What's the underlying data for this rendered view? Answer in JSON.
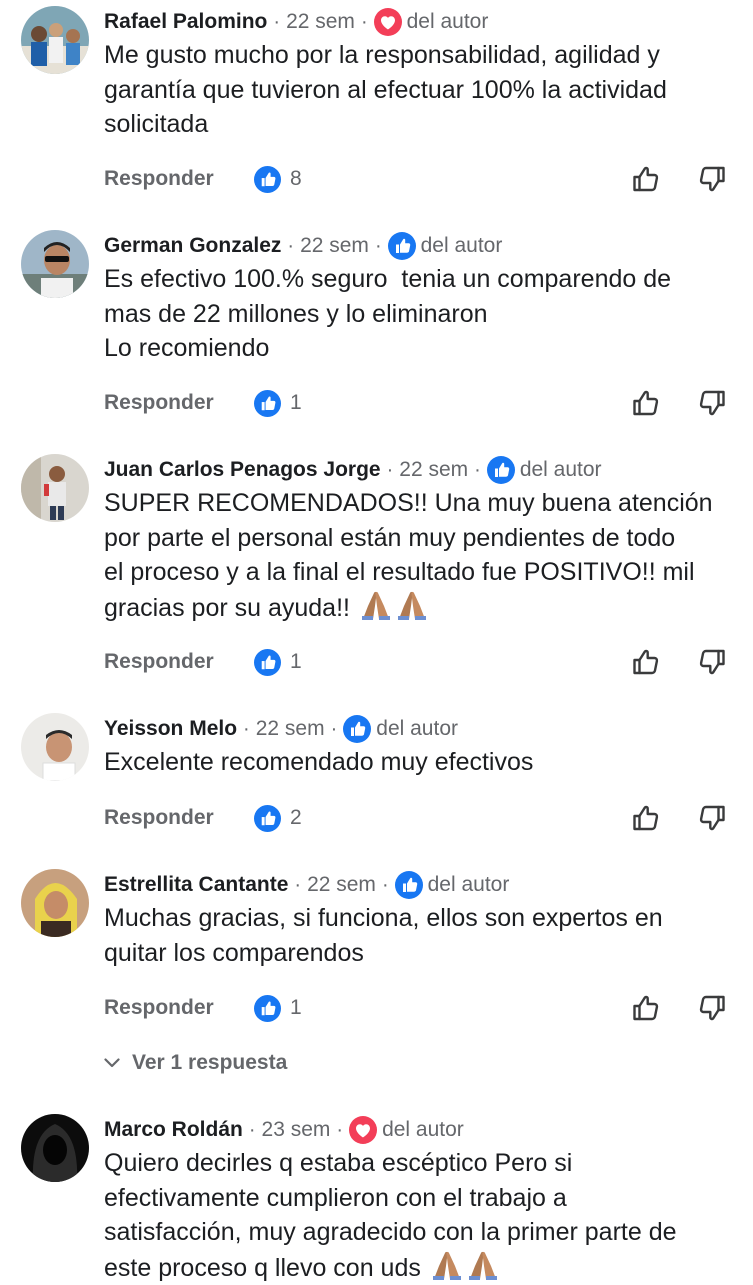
{
  "comments": [
    {
      "author": "Rafael Palomino",
      "time": "22 sem",
      "reaction": "heart",
      "author_reaction_label": "del autor",
      "text_lines": [
        "Me gusto mucho por la responsabilidad, agilidad y",
        "garantía que tuvieron al efectuar 100% la actividad",
        "solicitada"
      ],
      "reply_label": "Responder",
      "like_count": "8"
    },
    {
      "author": "German Gonzalez",
      "time": "22 sem",
      "reaction": "like",
      "author_reaction_label": "del autor",
      "text_lines": [
        "Es efectivo 100.% seguro  tenia un comparendo de",
        "mas de 22 millones y lo eliminaron",
        "Lo recomiendo"
      ],
      "reply_label": "Responder",
      "like_count": "1"
    },
    {
      "author": "Juan Carlos Penagos Jorge",
      "time": "22 sem",
      "reaction": "like",
      "author_reaction_label": "del autor",
      "text_lines": [
        "SUPER RECOMENDADOS!! Una muy buena atención",
        "por parte el personal están muy pendientes de todo",
        "el proceso y a la final el resultado fue POSITIVO!! mil",
        "gracias por su ayuda!!"
      ],
      "emoji_after": "🙏🏽🙏🏽",
      "reply_label": "Responder",
      "like_count": "1"
    },
    {
      "author": "Yeisson Melo",
      "time": "22 sem",
      "reaction": "like",
      "author_reaction_label": "del autor",
      "text_lines": [
        "Excelente recomendado muy efectivos"
      ],
      "reply_label": "Responder",
      "like_count": "2"
    },
    {
      "author": "Estrellita Cantante",
      "time": "22 sem",
      "reaction": "like",
      "author_reaction_label": "del autor",
      "text_lines": [
        "Muchas gracias, si funciona, ellos son expertos en",
        "quitar los comparendos"
      ],
      "reply_label": "Responder",
      "like_count": "1",
      "view_replies": "Ver 1 respuesta"
    },
    {
      "author": "Marco Roldán",
      "time": "23 sem",
      "reaction": "heart",
      "author_reaction_label": "del autor",
      "text_lines": [
        "Quiero decirles q estaba escéptico Pero si",
        "efectivamente cumplieron con el trabajo a",
        "satisfacción, muy agradecido con la primer parte de",
        "este proceso q llevo con uds"
      ],
      "emoji_after": "🙏🏽🙏🏽"
    }
  ],
  "separator": "·",
  "icons": {
    "like_badge": "like-badge-icon",
    "heart_badge": "heart-badge-icon",
    "thumb_up": "thumbs-up-icon",
    "thumb_down": "thumbs-down-icon",
    "chevron": "chevron-down-icon"
  },
  "colors": {
    "like_blue": "#1877f2",
    "heart_red": "#f33e58",
    "muted_text": "#65676b",
    "body_text": "#1c1e21"
  }
}
